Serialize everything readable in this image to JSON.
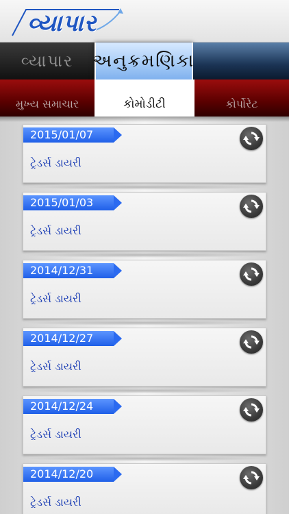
{
  "header": {
    "logo_text": "વ્યાપાર"
  },
  "tabs": [
    {
      "label": "વ્યાપાર",
      "active": false
    },
    {
      "label": "અનુક્રમણિકા",
      "active": true
    }
  ],
  "subtabs": [
    {
      "label": "મુખ્ય સમાચાર",
      "active": false
    },
    {
      "label": "કોમોડીટી",
      "active": true
    },
    {
      "label": "કોર્પોરેટ",
      "active": false
    }
  ],
  "items": [
    {
      "date": "2015/01/07",
      "title": "ટ્રેડર્સ ડાયરી"
    },
    {
      "date": "2015/01/03",
      "title": "ટ્રેડર્સ ડાયરી"
    },
    {
      "date": "2014/12/31",
      "title": "ટ્રેડર્સ ડાયરી"
    },
    {
      "date": "2014/12/27",
      "title": "ટ્રેડર્સ ડાયરી"
    },
    {
      "date": "2014/12/24",
      "title": "ટ્રેડર્સ ડાયરી"
    },
    {
      "date": "2014/12/20",
      "title": "ટ્રેડર્સ ડાયરી"
    }
  ],
  "colors": {
    "brand_blue": "#1f56c2",
    "active_tab": "#a9cdf7",
    "subtab_red": "#9b0d0d",
    "badge_blue": "#2b6af0",
    "title_blue": "#1d3fb5"
  },
  "icons": {
    "refresh": "refresh-icon"
  }
}
